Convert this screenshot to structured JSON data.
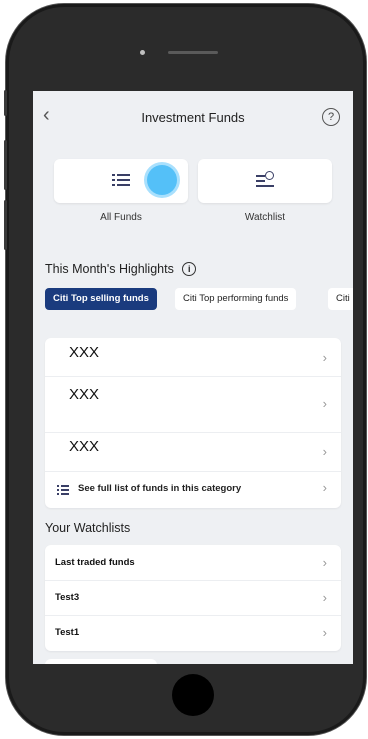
{
  "header": {
    "title": "Investment Funds",
    "back_icon": "chevron-left-icon",
    "help_icon": "question-circle-icon",
    "help_glyph": "?"
  },
  "tiles": [
    {
      "label": "All Funds",
      "icon": "list-icon"
    },
    {
      "label": "Watchlist",
      "icon": "watchlist-clock-icon"
    }
  ],
  "highlights": {
    "title": "This Month's Highlights",
    "info_glyph": "i",
    "chips": [
      "Citi Top selling funds",
      "Citi Top performing funds",
      "Citi"
    ],
    "active_chip_color": "#1a3b7e"
  },
  "funds": {
    "items": [
      "XXX",
      "XXX",
      "XXX"
    ],
    "see_all": "See full list of funds in this category"
  },
  "watchlists": {
    "title": "Your Watchlists",
    "items": [
      "Last traded funds",
      "Test3",
      "Test1"
    ]
  },
  "glyphs": {
    "chevron": "›",
    "back": "‹"
  }
}
